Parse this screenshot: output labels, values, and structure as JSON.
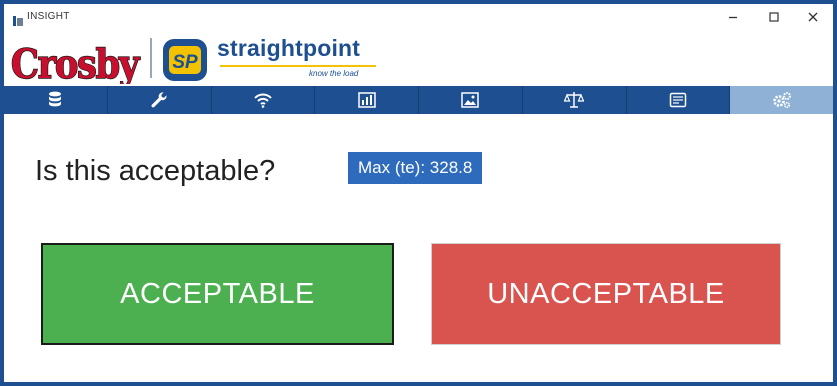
{
  "window": {
    "title": "INSIGHT",
    "controls": {
      "minimize": "–",
      "maximize": "☐",
      "close": "✕"
    }
  },
  "brand": {
    "crosby": "Crosby",
    "sp_badge": "SP",
    "sp_name": "straightpoint",
    "sp_tagline": "know the load"
  },
  "nav": {
    "items": [
      {
        "id": "database",
        "icon": "database-icon",
        "active": false
      },
      {
        "id": "settings",
        "icon": "wrench-icon",
        "active": false
      },
      {
        "id": "wireless",
        "icon": "wifi-icon",
        "active": false
      },
      {
        "id": "chart",
        "icon": "bar-chart-icon",
        "active": false
      },
      {
        "id": "image",
        "icon": "image-icon",
        "active": false
      },
      {
        "id": "scales",
        "icon": "scales-icon",
        "active": false
      },
      {
        "id": "report",
        "icon": "document-icon",
        "active": false
      },
      {
        "id": "config",
        "icon": "gears-icon",
        "active": true
      }
    ]
  },
  "main": {
    "question": "Is this acceptable?",
    "max_label": "Max (te): 328.8",
    "accept_label": "ACCEPTABLE",
    "reject_label": "UNACCEPTABLE"
  },
  "colors": {
    "brand_blue": "#1d4f91",
    "nav_active": "#8fb1d6",
    "badge_blue": "#2e6bbd",
    "accept_green": "#4cb050",
    "reject_red": "#d9534f",
    "crosby_red": "#c8102e",
    "sp_yellow": "#f3c200"
  }
}
